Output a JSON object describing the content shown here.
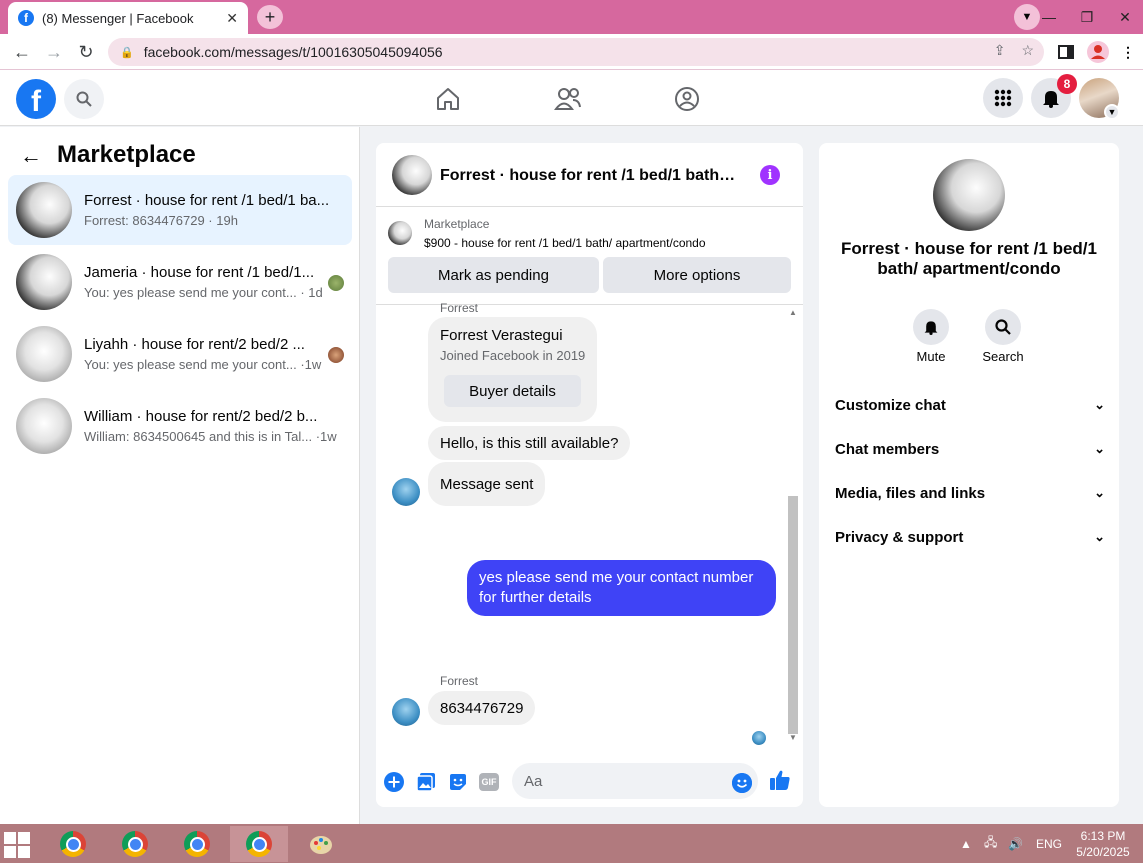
{
  "browser": {
    "tab_title": "(8) Messenger | Facebook",
    "tab_favicon": "f",
    "tab_close": "✕",
    "new_tab": "+",
    "url": "facebook.com/messages/t/10016305045094056",
    "window_buttons": [
      "—",
      "❐",
      "✕"
    ]
  },
  "fb_header": {
    "logo": "f",
    "notification_count": "8",
    "icons": [
      "search-icon",
      "home-icon",
      "friends-icon",
      "groups-icon",
      "menu-grid-icon",
      "bell-icon",
      "avatar"
    ]
  },
  "sidebar": {
    "back": "←",
    "title": "Marketplace",
    "conversations": [
      {
        "name": "Forrest · house for rent /1 bed/1 ba...",
        "sub": "Forrest: 8634476729 · 19h"
      },
      {
        "name": "Jameria · house for rent /1 bed/1...",
        "sub": "You: yes please send me your cont... · 1d"
      },
      {
        "name": "Liyahh · house for rent/2 bed/2 ...",
        "sub": "You: yes please send me your cont... ·1w"
      },
      {
        "name": "William · house for rent/2 bed/2 b...",
        "sub": "William: 8634500645 and this is in Tal... ·1w"
      }
    ]
  },
  "chat": {
    "title": "Forrest · house for rent /1 bed/1 bath…",
    "info_icon": "i",
    "marketplace_label": "Marketplace",
    "listing": "$900 - house for rent /1 bed/1 bath/ apartment/condo",
    "mark_pending": "Mark as pending",
    "more_options": "More options",
    "sender_top": "Forrest",
    "profile_name": "Forrest Verastegui",
    "profile_joined": "Joined Facebook in 2019",
    "buyer_details": "Buyer details",
    "msg1": "Hello, is this still available?",
    "msg2": "Message sent",
    "msg_out": "yes please send me your contact number for further details",
    "sender_bottom": "Forrest",
    "msg3": "8634476729",
    "composer_placeholder": "Aa",
    "gif_label": "GIF"
  },
  "info_panel": {
    "title": "Forrest · house for rent /1 bed/1 bath/ apartment/condo",
    "mute": "Mute",
    "search": "Search",
    "rows": [
      "Customize chat",
      "Chat members",
      "Media, files and links",
      "Privacy & support"
    ]
  },
  "taskbar": {
    "language": "ENG",
    "time": "6:13 PM",
    "date": "5/20/2025"
  },
  "colors": {
    "fb_blue": "#1877f2",
    "outgoing_bubble": "#3f43f6",
    "tabstrip": "#d6689e",
    "taskbar": "#b17a7e"
  }
}
